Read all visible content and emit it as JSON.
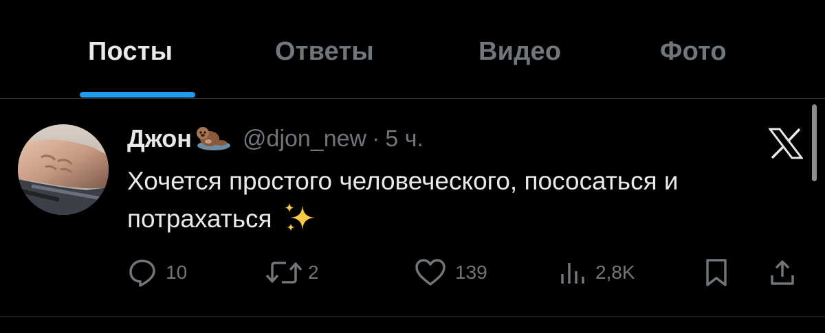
{
  "tabs": [
    {
      "label": "Посты",
      "active": true
    },
    {
      "label": "Ответы",
      "active": false
    },
    {
      "label": "Видео",
      "active": false
    },
    {
      "label": "Фото",
      "active": false
    }
  ],
  "post": {
    "display_name": "Джон",
    "name_emoji_icon": "otter-emoji-icon",
    "handle": "@djon_new",
    "separator": "·",
    "time": "5 ч.",
    "text": "Хочется простого человеческого, пососаться и потрахаться",
    "text_emoji_icon": "sparkles-emoji-icon",
    "platform_icon": "x-logo-icon",
    "actions": {
      "replies": "10",
      "reposts": "2",
      "likes": "139",
      "views": "2,8K"
    }
  },
  "colors": {
    "background": "#000000",
    "primary_text": "#e7e9ea",
    "secondary_text": "#71767b",
    "accent": "#1d9bf0",
    "divider": "#2f3336"
  }
}
